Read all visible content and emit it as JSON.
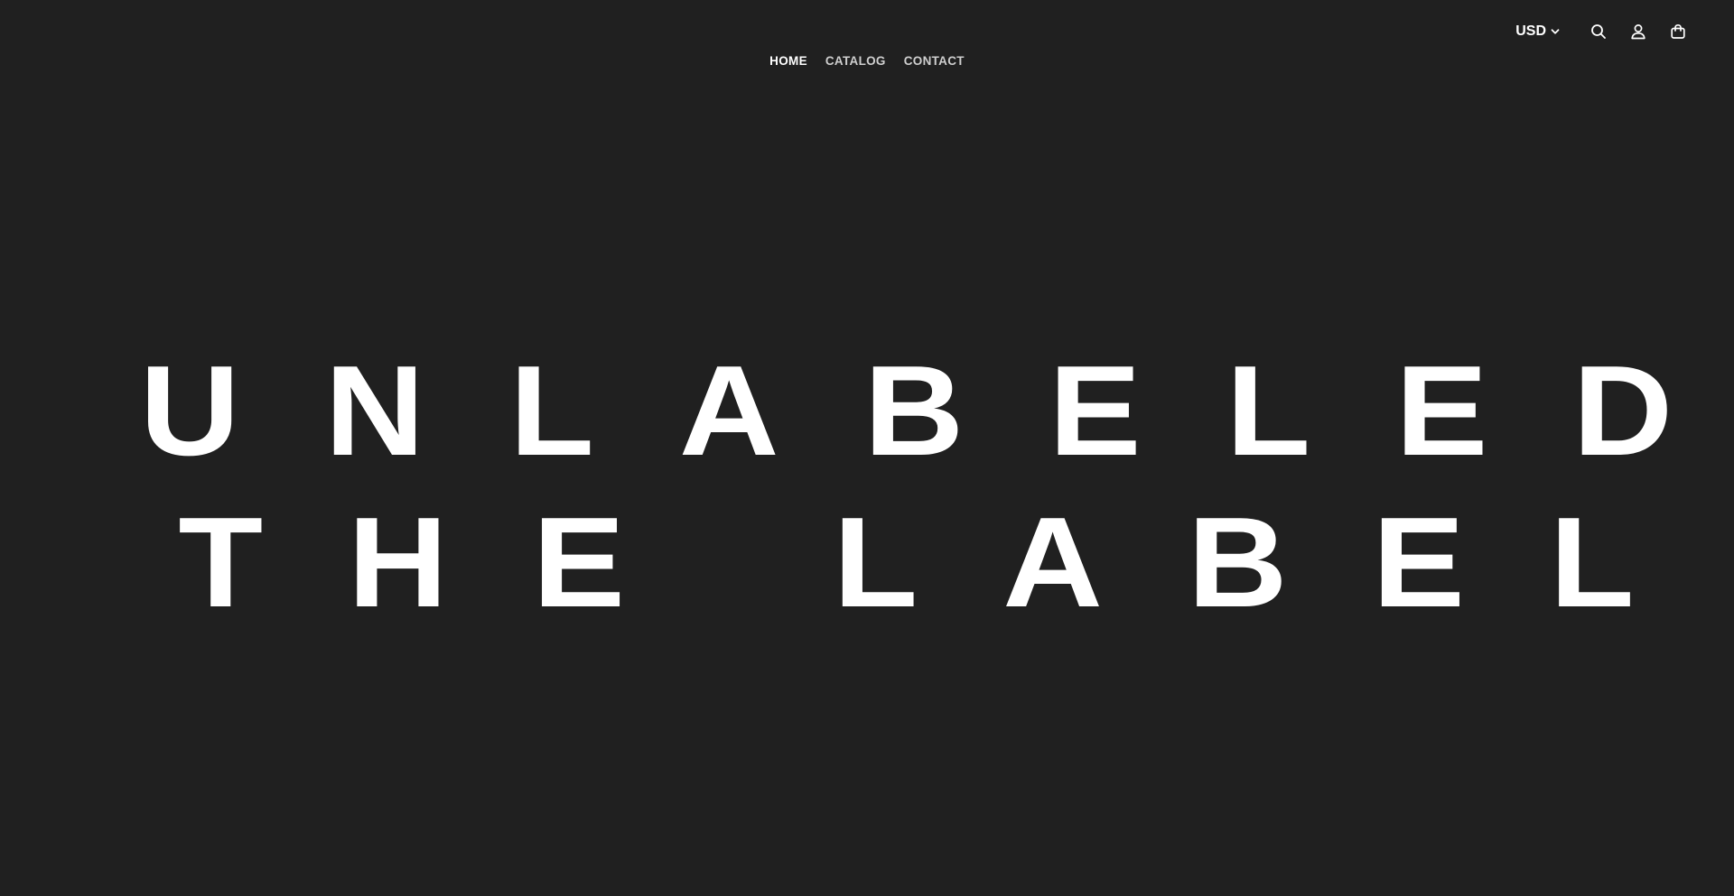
{
  "header": {
    "currency": "USD",
    "icons": [
      "search-icon",
      "account-icon",
      "cart-icon"
    ]
  },
  "nav": {
    "items": [
      {
        "label": "HOME",
        "active": true
      },
      {
        "label": "CATALOG",
        "active": false
      },
      {
        "label": "CONTACT",
        "active": false
      }
    ]
  },
  "hero": {
    "line1": "UNLABELED",
    "line2": "THE LABEL"
  },
  "colors": {
    "background": "#202020",
    "text": "#ffffff",
    "nav_inactive": "#cfcfcf"
  }
}
